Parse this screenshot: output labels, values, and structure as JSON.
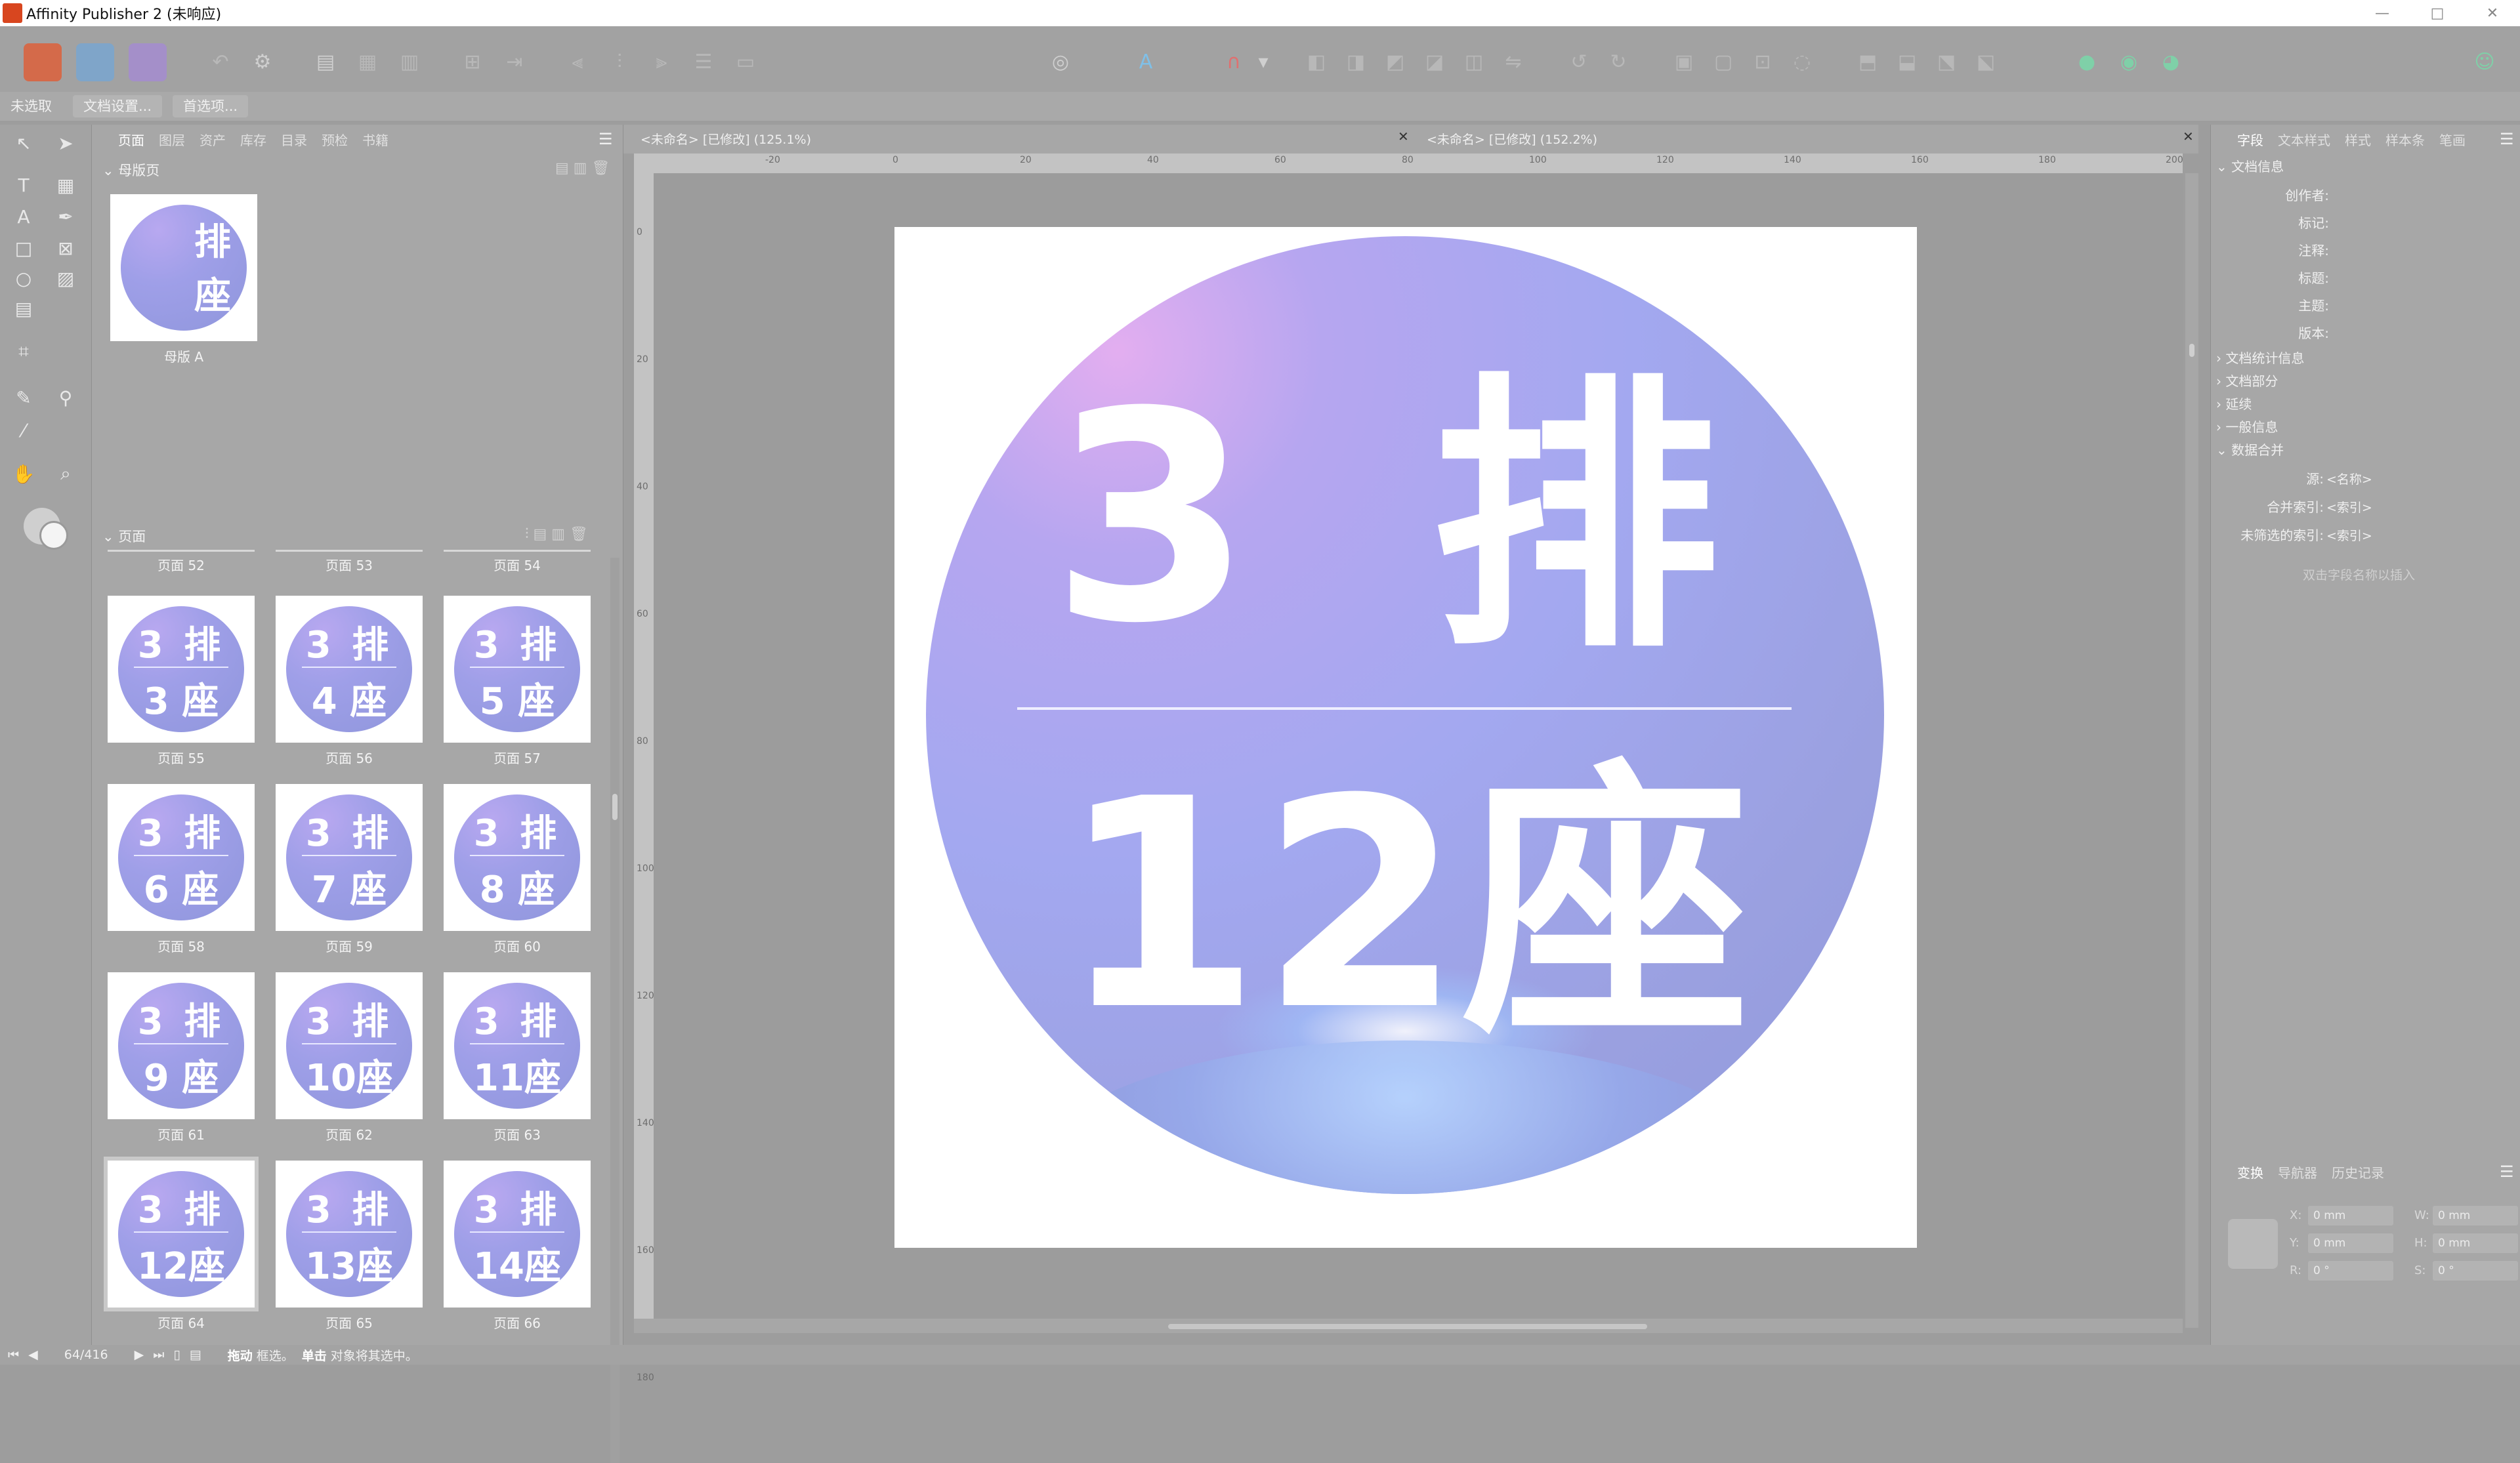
{
  "window": {
    "title": "Affinity Publisher 2 (未响应)",
    "minimize": "—",
    "maximize": "□",
    "close": "✕"
  },
  "context": {
    "label": "未选取",
    "doc_setup": "文档设置...",
    "prefs": "首选项..."
  },
  "left_panel": {
    "tabs": [
      "页面",
      "图层",
      "资产",
      "库存",
      "目录",
      "预检",
      "书籍"
    ],
    "master_section": "母版页",
    "master": {
      "top": "排",
      "bottom": "座",
      "label": "母版 A"
    },
    "pages_section": "页面",
    "partial_labels": [
      "页面 52",
      "页面 53",
      "页面 54"
    ],
    "pages": [
      {
        "top": "3 排",
        "bottom": "3 座",
        "label": "页面 55"
      },
      {
        "top": "3 排",
        "bottom": "4 座",
        "label": "页面 56"
      },
      {
        "top": "3 排",
        "bottom": "5 座",
        "label": "页面 57"
      },
      {
        "top": "3 排",
        "bottom": "6 座",
        "label": "页面 58"
      },
      {
        "top": "3 排",
        "bottom": "7 座",
        "label": "页面 59"
      },
      {
        "top": "3 排",
        "bottom": "8 座",
        "label": "页面 60"
      },
      {
        "top": "3 排",
        "bottom": "9 座",
        "label": "页面 61"
      },
      {
        "top": "3 排",
        "bottom": "10座",
        "label": "页面 62"
      },
      {
        "top": "3 排",
        "bottom": "11座",
        "label": "页面 63"
      },
      {
        "top": "3 排",
        "bottom": "12座",
        "label": "页面 64",
        "selected": true
      },
      {
        "top": "3 排",
        "bottom": "13座",
        "label": "页面 65"
      },
      {
        "top": "3 排",
        "bottom": "14座",
        "label": "页面 66"
      }
    ]
  },
  "doc_tabs": [
    "<未命名> [已修改] (125.1%)",
    "<未命名> [已修改] (152.2%)"
  ],
  "rulers": {
    "h": [
      "-20",
      "0",
      "20",
      "40",
      "60",
      "80",
      "100",
      "120",
      "140",
      "160",
      "180",
      "200"
    ],
    "v": [
      "0",
      "20",
      "40",
      "60",
      "80",
      "100",
      "120",
      "140",
      "160",
      "180"
    ]
  },
  "page_content": {
    "top": "3 排",
    "bottom": "12座"
  },
  "right_panel": {
    "tabs": [
      "字段",
      "文本样式",
      "样式",
      "样本条",
      "笔画"
    ],
    "doc_info": "文档信息",
    "fields": [
      "创作者:",
      "标记:",
      "注释:",
      "标题:",
      "主题:",
      "版本:"
    ],
    "tree": [
      "文档统计信息",
      "文档部分",
      "延续",
      "一般信息",
      "数据合并"
    ],
    "merge_fields": [
      {
        "label": "源:",
        "value": "<名称>"
      },
      {
        "label": "合并索引:",
        "value": "<索引>"
      },
      {
        "label": "未筛选的索引:",
        "value": "<索引>"
      }
    ],
    "hint": "双击字段名称以插入",
    "transform_tabs": [
      "变换",
      "导航器",
      "历史记录"
    ],
    "transform": [
      {
        "label": "X:",
        "value": "0 mm"
      },
      {
        "label": "W:",
        "value": "0 mm"
      },
      {
        "label": "Y:",
        "value": "0 mm"
      },
      {
        "label": "H:",
        "value": "0 mm"
      },
      {
        "label": "R:",
        "value": "0 °"
      },
      {
        "label": "S:",
        "value": "0 °"
      }
    ]
  },
  "status": {
    "page": "64/416",
    "drag": "拖动",
    "drag_desc": "框选。",
    "click": "单击",
    "click_desc": "对象将其选中。"
  }
}
